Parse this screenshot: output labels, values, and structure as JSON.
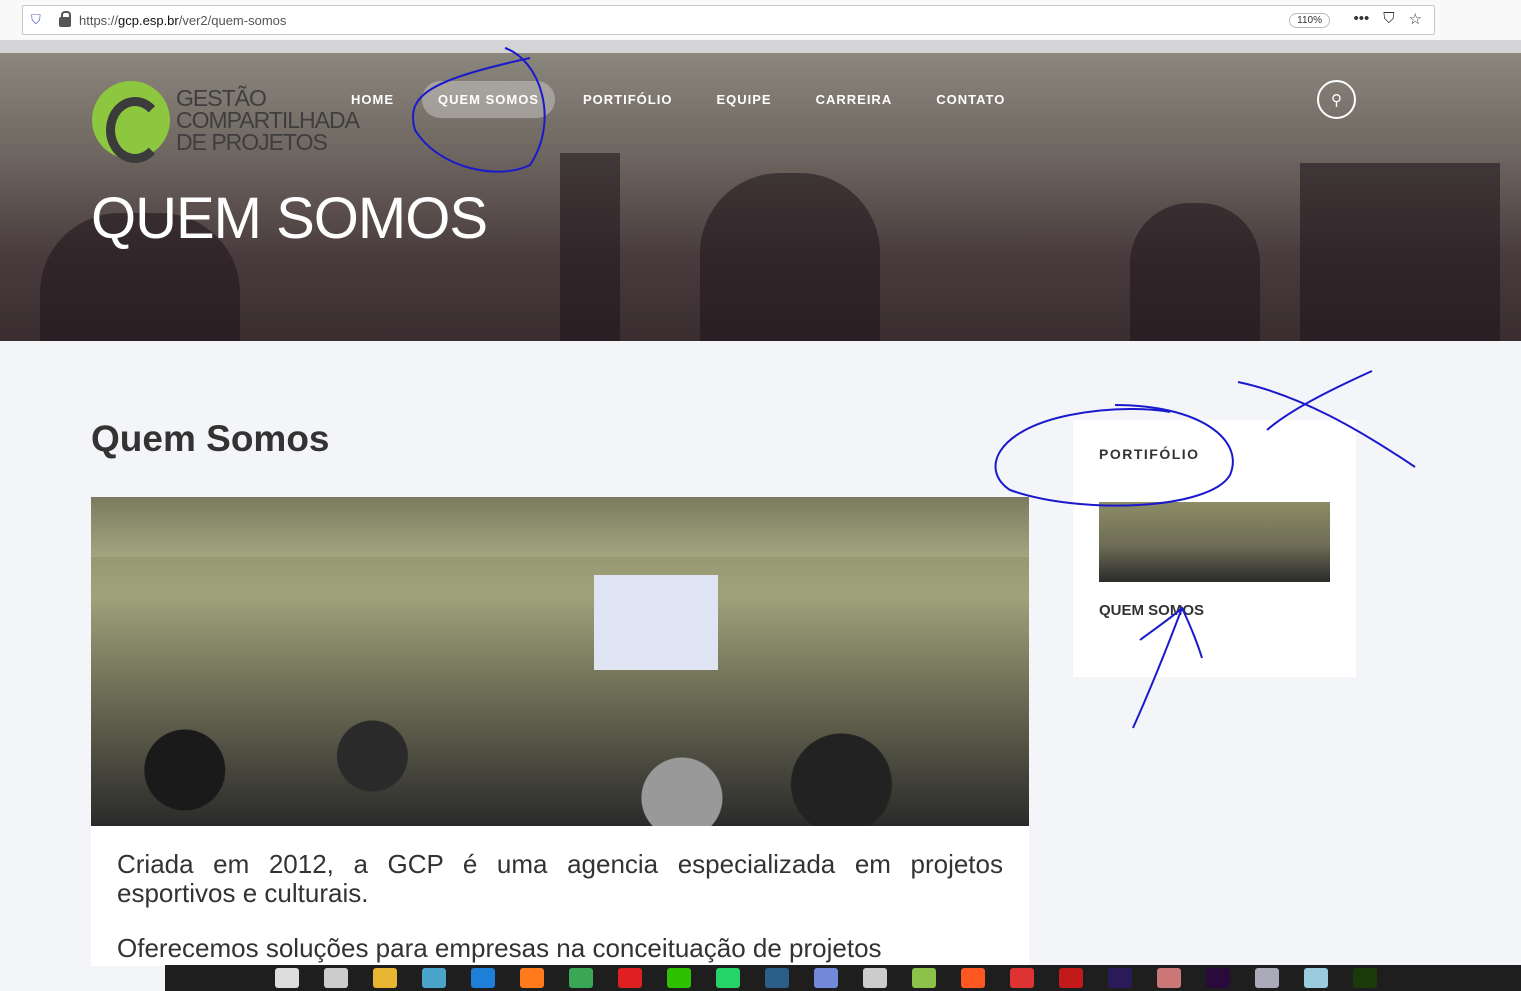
{
  "browser": {
    "url_prefix": "https://",
    "url_domain": "gcp.esp.br",
    "url_path": "/ver2/quem-somos",
    "zoom": "110%"
  },
  "logo": {
    "line1": "GESTÃO",
    "line2": "COMPARTILHADA",
    "line3": "DE PROJETOS"
  },
  "nav": [
    {
      "label": "HOME"
    },
    {
      "label": "QUEM SOMOS"
    },
    {
      "label": "PORTIFÓLIO"
    },
    {
      "label": "EQUIPE"
    },
    {
      "label": "CARREIRA"
    },
    {
      "label": "CONTATO"
    }
  ],
  "hero": {
    "title": "QUEM SOMOS"
  },
  "main": {
    "title": "Quem Somos",
    "paragraphs": [
      "Criada em 2012, a GCP é uma agencia especializada em projetos esportivos e culturais.",
      "Oferecemos soluções para empresas na conceituação de projetos"
    ]
  },
  "sidebar": {
    "heading": "PORTIFÓLIO",
    "link": "QUEM SOMOS"
  },
  "taskbar": {
    "icons": [
      "calculator",
      "settings",
      "file-explorer",
      "media",
      "edge",
      "firefox",
      "chrome",
      "opera",
      "wechat",
      "whatsapp",
      "headset",
      "discord",
      "app",
      "app",
      "camera",
      "app",
      "filezilla",
      "after-effects",
      "app",
      "premiere",
      "app",
      "app",
      "dreamweaver"
    ]
  },
  "colors": {
    "annotation": "#1a1acc",
    "logo_green": "#8dc63f"
  }
}
